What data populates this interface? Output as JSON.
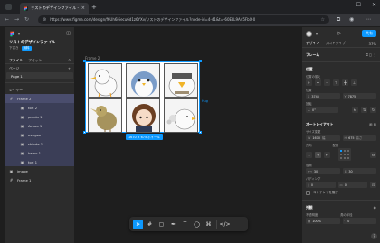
{
  "browser": {
    "tab_title": "リストのデザインファイル – Figma",
    "url": "https://www.figma.com/design/f6Uh6i6ecu6d1z6YXv/リストのデザインファイル?node-id=4-41&t=-60ELL9A45FbX-0",
    "new_tab": "+",
    "minimize": "–",
    "maximize": "☐",
    "close": "✕"
  },
  "left_panel": {
    "project_title": "リストのデザインファイル",
    "project_draft": "下書き",
    "project_badge": "無料",
    "tabs": [
      "ファイル",
      "アセット"
    ],
    "pages_label": "ページ",
    "pages": [
      {
        "label": "Page 1"
      }
    ],
    "layers_label": "レイヤー",
    "layers": [
      {
        "label": "Frame 2",
        "icon": "#",
        "indent": 0,
        "state": "sel"
      },
      {
        "label": "tori 2",
        "icon": "▣",
        "indent": 2,
        "state": "child"
      },
      {
        "label": "panda 1",
        "icon": "▣",
        "indent": 2,
        "state": "child"
      },
      {
        "label": "Achoo 1",
        "icon": "▣",
        "indent": 2,
        "state": "child"
      },
      {
        "label": "nangen 1",
        "icon": "▣",
        "indent": 2,
        "state": "child"
      },
      {
        "label": "shinde 1",
        "icon": "▣",
        "indent": 2,
        "state": "child"
      },
      {
        "label": "kamo 1",
        "icon": "▣",
        "indent": 2,
        "state": "child"
      },
      {
        "label": "tori 1",
        "icon": "▣",
        "indent": 2,
        "state": "child"
      },
      {
        "label": "image",
        "icon": "▣",
        "indent": 0,
        "state": ""
      },
      {
        "label": "Frame 1",
        "icon": "#",
        "indent": 0,
        "state": ""
      }
    ]
  },
  "canvas": {
    "frame_label": "Frame 2",
    "size_badge": "1670 × 675 ホイール",
    "side_w": "Hug"
  },
  "right_panel": {
    "share_label": "共有",
    "zoom": "37%",
    "tabs": [
      "デザイン",
      "プロトタイプ"
    ],
    "frame_label": "フレーム",
    "position_label": "位置",
    "align_label": "位置の揃え",
    "pos_label": "位置",
    "x": "3745",
    "y": "7875",
    "rotation_label": "回転",
    "rotation": "0°",
    "autolayout_label": "オートレイアウト",
    "size_label": "サイズ変更",
    "w": "1670",
    "h": "675",
    "w_mode": "幅",
    "h_mode": "高さ",
    "dir_label": "方向",
    "align2_label": "配置",
    "gap_label": "間隔",
    "gap": "30",
    "gap2": "30",
    "padding_label": "パディング",
    "pad_h": "0",
    "pad_v": "0",
    "clip_label": "コンテンツを隠す",
    "layout_label": "外観",
    "layout_sub1": "不透明度",
    "layout_sub2": "角の半径",
    "opacity": "100%",
    "radius": "0"
  }
}
